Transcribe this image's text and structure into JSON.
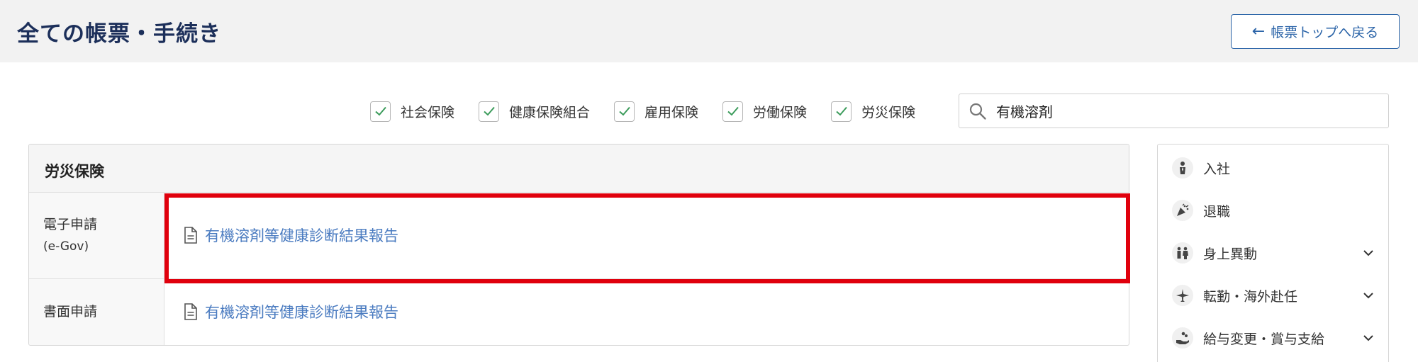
{
  "header": {
    "title": "全ての帳票・手続き",
    "back_button_label": "帳票トップへ戻る",
    "back_arrow": "←"
  },
  "filters": [
    {
      "label": "社会保険",
      "checked": true
    },
    {
      "label": "健康保険組合",
      "checked": true
    },
    {
      "label": "雇用保険",
      "checked": true
    },
    {
      "label": "労働保険",
      "checked": true
    },
    {
      "label": "労災保険",
      "checked": true
    }
  ],
  "search": {
    "value": "有機溶剤",
    "icon": "search-icon"
  },
  "table": {
    "heading": "労災保険",
    "rows": [
      {
        "label": "電子申請",
        "sublabel": "(e-Gov)",
        "link": "有機溶剤等健康診断結果報告",
        "highlighted": true
      },
      {
        "label": "書面申請",
        "sublabel": "",
        "link": "有機溶剤等健康診断結果報告",
        "highlighted": false
      }
    ]
  },
  "side_menu": {
    "items": [
      {
        "label": "入社",
        "icon": "person-tie-icon",
        "expandable": false
      },
      {
        "label": "退職",
        "icon": "party-popper-icon",
        "expandable": false
      },
      {
        "label": "身上異動",
        "icon": "family-icon",
        "expandable": true
      },
      {
        "label": "転勤・海外赴任",
        "icon": "airplane-icon",
        "expandable": true
      },
      {
        "label": "給与変更・賞与支給",
        "icon": "coins-hand-icon",
        "expandable": true
      }
    ]
  },
  "colors": {
    "title": "#1c2f5a",
    "link": "#4a7bc0",
    "accent_button": "#2b64a8",
    "highlight": "#e0000d",
    "check": "#3a9b5a"
  }
}
